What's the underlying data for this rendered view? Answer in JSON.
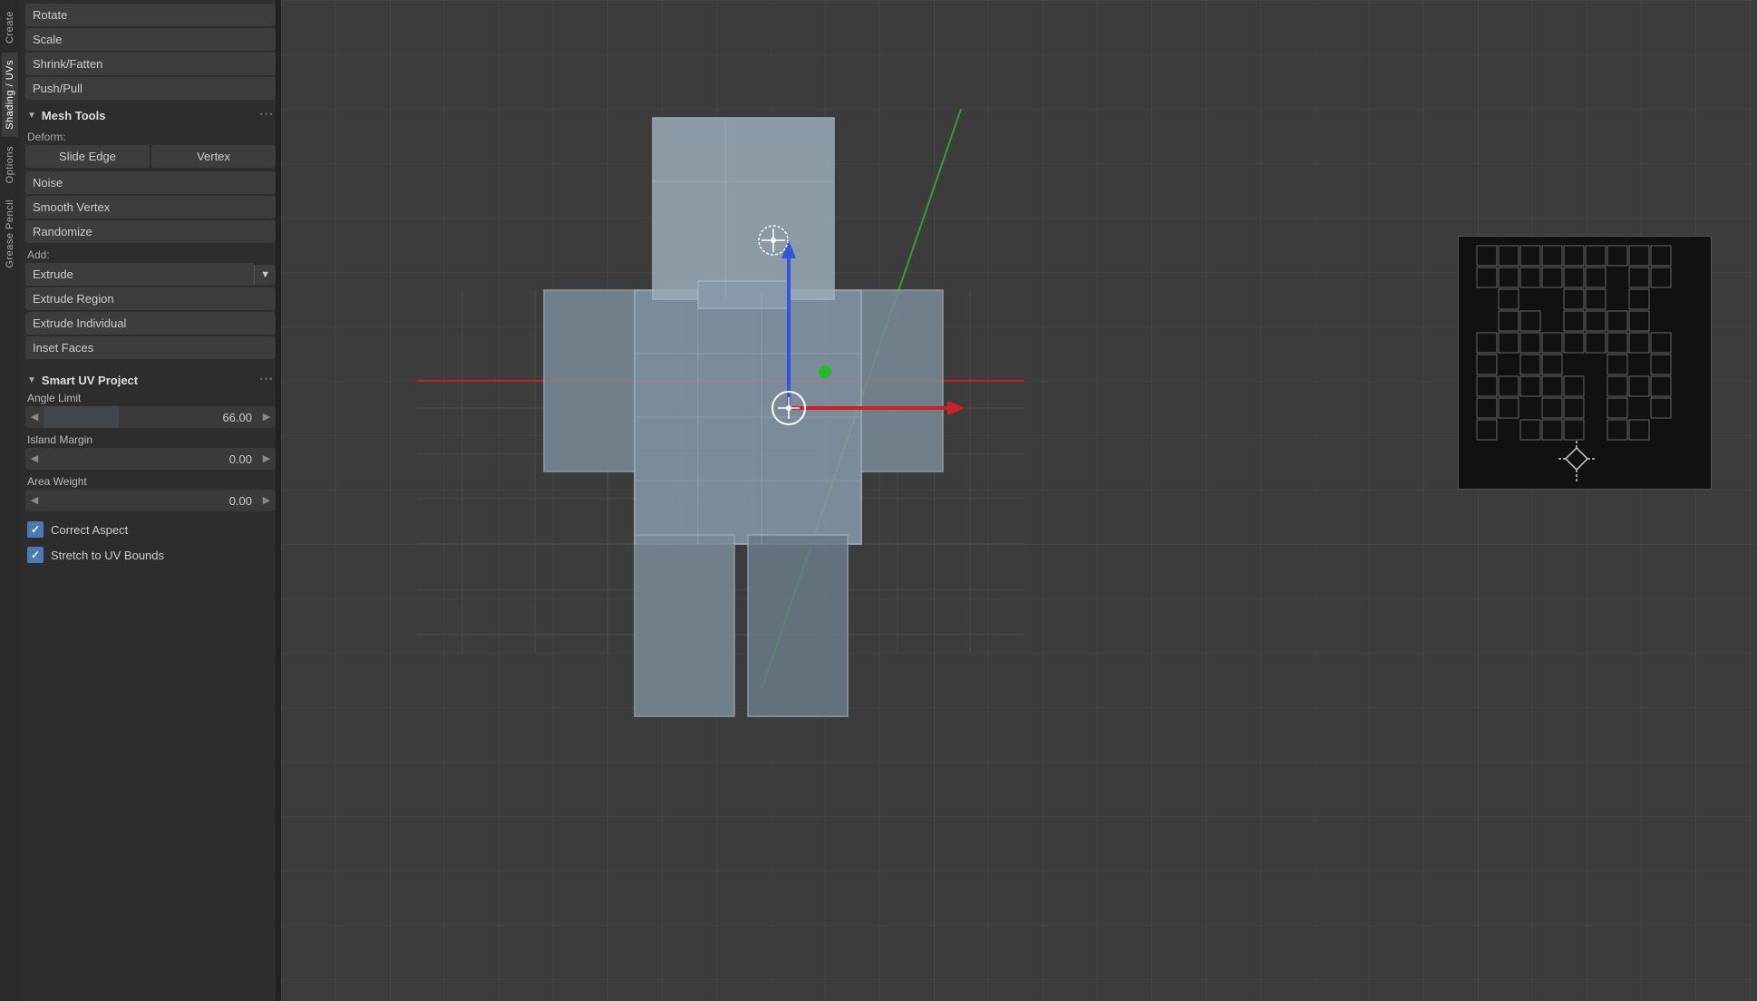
{
  "tabs": {
    "create": "Create",
    "shading_uvs": "Shading / UVs",
    "options": "Options",
    "grease_pencil": "Grease Pencil"
  },
  "toolbar": {
    "buttons": [
      {
        "id": "rotate",
        "label": "Rotate"
      },
      {
        "id": "scale",
        "label": "Scale"
      },
      {
        "id": "shrink_fatten",
        "label": "Shrink/Fatten"
      },
      {
        "id": "push_pull",
        "label": "Push/Pull"
      }
    ],
    "mesh_tools": {
      "title": "Mesh Tools",
      "deform_label": "Deform:",
      "slide_edge": "Slide Edge",
      "vertex": "Vertex",
      "noise": "Noise",
      "smooth_vertex": "Smooth Vertex",
      "randomize": "Randomize",
      "add_label": "Add:",
      "extrude": "Extrude",
      "extrude_region": "Extrude Region",
      "extrude_individual": "Extrude Individual",
      "inset_faces": "Inset Faces"
    },
    "smart_uv": {
      "title": "Smart UV Project",
      "angle_limit_label": "Angle Limit",
      "angle_limit_value": "66.00",
      "island_margin_label": "Island Margin",
      "island_margin_value": "0.00",
      "area_weight_label": "Area Weight",
      "area_weight_value": "0.00",
      "correct_aspect_label": "Correct Aspect",
      "correct_aspect_checked": true,
      "stretch_to_uv_label": "Stretch to UV Bounds",
      "stretch_to_uv_checked": true
    }
  },
  "icons": {
    "arrow_down": "▼",
    "arrow_left": "◀",
    "arrow_right": "▶",
    "check": "✓",
    "dots": "···"
  },
  "colors": {
    "accent_blue": "#4a7ab5",
    "bg_dark": "#2d2d2d",
    "bg_panel": "#3d3d3d",
    "axis_red": "#cc2222",
    "axis_green": "#22aa22",
    "axis_blue": "#2244cc"
  }
}
